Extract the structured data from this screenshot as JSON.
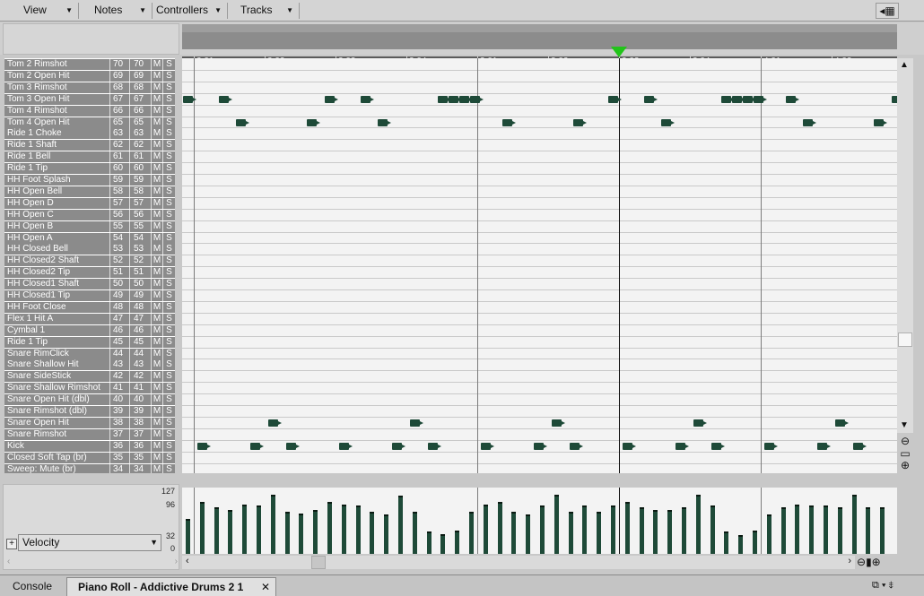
{
  "menus": [
    {
      "label": "View"
    },
    {
      "label": "Notes"
    },
    {
      "label": "Controllers"
    },
    {
      "label": "Tracks"
    }
  ],
  "ruler": {
    "ticks": [
      "2:01",
      "2:02",
      "2:03",
      "2:04",
      "3:01",
      "3:02",
      "3:03",
      "3:04",
      "4:01",
      "4:02"
    ],
    "playhead_label": "3:03"
  },
  "keys": [
    {
      "name": "Tom 2 Rimshot",
      "n1": "70",
      "n2": "70",
      "m": "M",
      "s": "S"
    },
    {
      "name": "Tom 2 Open Hit",
      "n1": "69",
      "n2": "69",
      "m": "M",
      "s": "S"
    },
    {
      "name": "Tom 3 Rimshot",
      "n1": "68",
      "n2": "68",
      "m": "M",
      "s": "S"
    },
    {
      "name": "Tom 3 Open Hit",
      "n1": "67",
      "n2": "67",
      "m": "M",
      "s": "S"
    },
    {
      "name": "Tom 4 Rimshot",
      "n1": "66",
      "n2": "66",
      "m": "M",
      "s": "S"
    },
    {
      "name": "Tom 4 Open Hit",
      "n1": "65",
      "n2": "65",
      "m": "M",
      "s": "S"
    },
    {
      "name": "Ride 1 Choke",
      "n1": "63",
      "n2": "63",
      "m": "M",
      "s": "S"
    },
    {
      "name": "Ride 1 Shaft",
      "n1": "62",
      "n2": "62",
      "m": "M",
      "s": "S"
    },
    {
      "name": "Ride 1 Bell",
      "n1": "61",
      "n2": "61",
      "m": "M",
      "s": "S"
    },
    {
      "name": "Ride 1 Tip",
      "n1": "60",
      "n2": "60",
      "m": "M",
      "s": "S"
    },
    {
      "name": "HH Foot Splash",
      "n1": "59",
      "n2": "59",
      "m": "M",
      "s": "S"
    },
    {
      "name": "HH Open Bell",
      "n1": "58",
      "n2": "58",
      "m": "M",
      "s": "S"
    },
    {
      "name": "HH Open D",
      "n1": "57",
      "n2": "57",
      "m": "M",
      "s": "S"
    },
    {
      "name": "HH Open C",
      "n1": "56",
      "n2": "56",
      "m": "M",
      "s": "S"
    },
    {
      "name": "HH Open B",
      "n1": "55",
      "n2": "55",
      "m": "M",
      "s": "S"
    },
    {
      "name": "HH Open A",
      "n1": "54",
      "n2": "54",
      "m": "M",
      "s": "S"
    },
    {
      "name": "HH Closed Bell",
      "n1": "53",
      "n2": "53",
      "m": "M",
      "s": "S"
    },
    {
      "name": "HH Closed2 Shaft",
      "n1": "52",
      "n2": "52",
      "m": "M",
      "s": "S"
    },
    {
      "name": "HH Closed2 Tip",
      "n1": "51",
      "n2": "51",
      "m": "M",
      "s": "S"
    },
    {
      "name": "HH Closed1 Shaft",
      "n1": "50",
      "n2": "50",
      "m": "M",
      "s": "S"
    },
    {
      "name": "HH Closed1 Tip",
      "n1": "49",
      "n2": "49",
      "m": "M",
      "s": "S"
    },
    {
      "name": "HH Foot Close",
      "n1": "48",
      "n2": "48",
      "m": "M",
      "s": "S"
    },
    {
      "name": "Flex 1 Hit A",
      "n1": "47",
      "n2": "47",
      "m": "M",
      "s": "S"
    },
    {
      "name": "Cymbal 1",
      "n1": "46",
      "n2": "46",
      "m": "M",
      "s": "S"
    },
    {
      "name": "Ride 1 Tip",
      "n1": "45",
      "n2": "45",
      "m": "M",
      "s": "S"
    },
    {
      "name": "Snare RimClick",
      "n1": "44",
      "n2": "44",
      "m": "M",
      "s": "S"
    },
    {
      "name": "Snare Shallow Hit",
      "n1": "43",
      "n2": "43",
      "m": "M",
      "s": "S"
    },
    {
      "name": "Snare SideStick",
      "n1": "42",
      "n2": "42",
      "m": "M",
      "s": "S"
    },
    {
      "name": "Snare Shallow Rimshot",
      "n1": "41",
      "n2": "41",
      "m": "M",
      "s": "S"
    },
    {
      "name": "Snare Open Hit (dbl)",
      "n1": "40",
      "n2": "40",
      "m": "M",
      "s": "S"
    },
    {
      "name": "Snare Rimshot (dbl)",
      "n1": "39",
      "n2": "39",
      "m": "M",
      "s": "S"
    },
    {
      "name": "Snare Open Hit",
      "n1": "38",
      "n2": "38",
      "m": "M",
      "s": "S"
    },
    {
      "name": "Snare Rimshot",
      "n1": "37",
      "n2": "37",
      "m": "M",
      "s": "S"
    },
    {
      "name": "Kick",
      "n1": "36",
      "n2": "36",
      "m": "M",
      "s": "S"
    },
    {
      "name": "Closed Soft Tap (br)",
      "n1": "35",
      "n2": "35",
      "m": "M",
      "s": "S"
    },
    {
      "name": "Sweep: Mute (br)",
      "n1": "34",
      "n2": "34",
      "m": "M",
      "s": "S"
    }
  ],
  "notes": [
    {
      "pitch": 67,
      "beats": [
        0.0,
        0.5,
        2.0,
        2.5,
        3.6,
        3.75,
        3.9,
        4.05,
        6.0,
        6.5,
        7.6,
        7.75,
        7.9,
        8.05,
        8.5,
        10.0
      ]
    },
    {
      "pitch": 65,
      "beats": [
        0.75,
        1.75,
        2.75,
        4.5,
        5.5,
        6.75,
        8.75,
        9.75
      ]
    },
    {
      "pitch": 38,
      "beats": [
        1.2,
        3.2,
        5.2,
        7.2,
        9.2
      ]
    },
    {
      "pitch": 36,
      "beats": [
        0.2,
        0.95,
        1.45,
        2.2,
        2.95,
        3.45,
        4.2,
        4.95,
        5.45,
        6.2,
        6.95,
        7.45,
        8.2,
        8.95,
        9.45
      ]
    }
  ],
  "velocity": {
    "controller": "Velocity",
    "scale": [
      "127",
      "96",
      "32",
      "0"
    ],
    "values": [
      70,
      105,
      95,
      88,
      100,
      98,
      120,
      85,
      82,
      88,
      105,
      100,
      98,
      85,
      80,
      118,
      85,
      45,
      40,
      48,
      85,
      100,
      105,
      85,
      80,
      98,
      120,
      85,
      98,
      85,
      98,
      105,
      95,
      88,
      88,
      95,
      120,
      98,
      45,
      38,
      48,
      80,
      95,
      100,
      98,
      98,
      95,
      120,
      95,
      95
    ]
  },
  "tabs": [
    {
      "label": "Console"
    },
    {
      "label": "Piano Roll - Addictive Drums 2 1"
    }
  ]
}
